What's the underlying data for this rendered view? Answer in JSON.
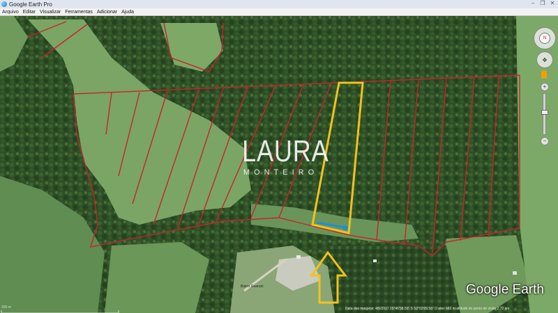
{
  "window": {
    "title": "Google Earth Pro",
    "controls": [
      "–",
      "❐",
      "✕"
    ]
  },
  "menu": [
    "Arquivo",
    "Editar",
    "Visualizar",
    "Ferramentas",
    "Adicionar",
    "Ajuda"
  ],
  "watermark": {
    "line1": "LAURA",
    "line2": "MONTEIRO"
  },
  "brand": "Google Earth",
  "status": "Data das imagens: 4/5/2017   25°46'58.59\" S  52°02'09.56\" O  elev  682 m   altitude do ponto de visão  2.72 km",
  "scale": {
    "label": "200 m"
  },
  "place_label": "Bairro Guarani",
  "nav": {
    "compass_label": "N",
    "zoom_in": "+",
    "zoom_out": "−",
    "zoom_level": 0.55
  },
  "colors": {
    "boundary": "#c8232c",
    "highlight": "#f2c21b",
    "arrow": "#f2c21b",
    "water": "#1e8fd6"
  }
}
